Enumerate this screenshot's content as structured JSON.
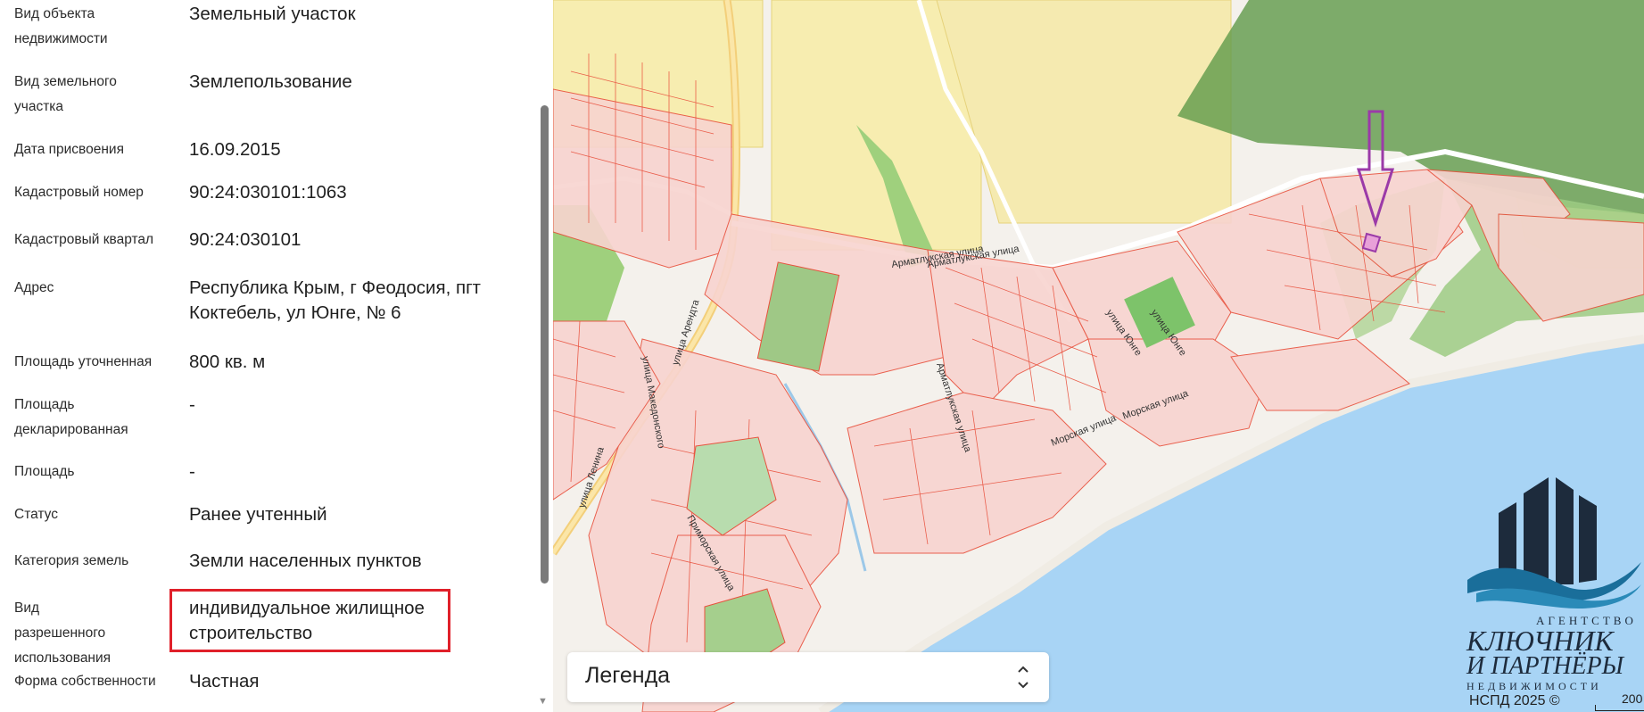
{
  "properties": [
    {
      "label": "Вид объекта недвижимости",
      "value": "Земельный участок"
    },
    {
      "label": "Вид земельного участка",
      "value": "Землепользование"
    },
    {
      "label": "Дата присвоения",
      "value": "16.09.2015"
    },
    {
      "label": "Кадастровый номер",
      "value": "90:24:030101:1063"
    },
    {
      "label": "Кадастровый квартал",
      "value": "90:24:030101"
    },
    {
      "label": "Адрес",
      "value": "Республика Крым, г Феодосия, пгт Коктебель, ул Юнге, № 6"
    },
    {
      "label": "Площадь уточненная",
      "value": "800 кв. м"
    },
    {
      "label": "Площадь декларированная",
      "value": "-"
    },
    {
      "label": "Площадь",
      "value": "-"
    },
    {
      "label": "Статус",
      "value": "Ранее учтенный"
    },
    {
      "label": "Категория земель",
      "value": "Земли населенных пунктов"
    },
    {
      "label": "Вид разрешенного использования",
      "value": "индивидуальное жилищное строительство"
    },
    {
      "label": "Форма собственности",
      "value": "Частная"
    }
  ],
  "map": {
    "streets": [
      "улица Юнге",
      "Арматлукская улица",
      "Арматлукская улица",
      "улица Юнге",
      "Морская улица",
      "Морская улица",
      "улица Македонского",
      "улица Арендта",
      "Приморская улица",
      "улица Ленина",
      "Арматлукская улица",
      "улица Юнге"
    ],
    "legend_label": "Легенда",
    "legend_toggle_icon": "chevron-updown-icon",
    "attribution": "НСПД 2025 ©",
    "scale_label": "200"
  },
  "logo": {
    "line1": "АГЕНТСТВО",
    "line2": "КЛЮЧНИК",
    "line3": "И ПАРТНЁРЫ",
    "line4": "НЕДВИЖИМОСТИ"
  },
  "colors": {
    "highlight": "#e0202a",
    "parcel_fill": "#f8d4d0",
    "parcel_stroke": "#e8503c",
    "sea": "#a8d4f5",
    "forest": "#6aa050",
    "marker_arrow": "#9b3aa8"
  }
}
